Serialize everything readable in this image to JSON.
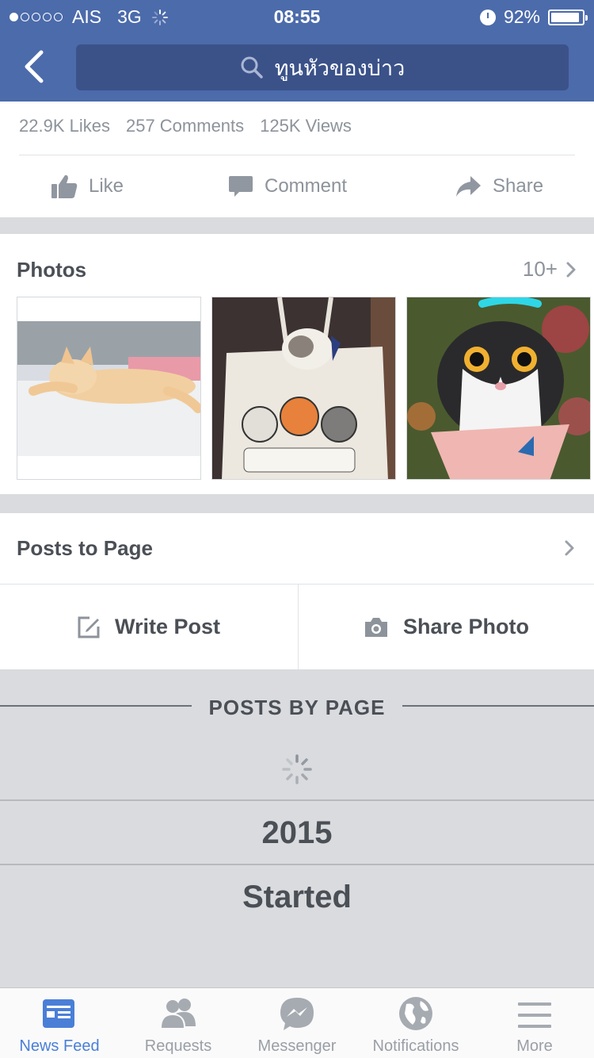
{
  "status_bar": {
    "carrier": "AIS",
    "network": "3G",
    "time": "08:55",
    "battery": "92%"
  },
  "nav": {
    "search_text": "ทูนหัวของบ่าว"
  },
  "stats": {
    "likes": "22.9K Likes",
    "comments": "257 Comments",
    "views": "125K Views"
  },
  "actions": {
    "like": "Like",
    "comment": "Comment",
    "share": "Share"
  },
  "photos": {
    "title": "Photos",
    "more": "10+"
  },
  "posts": {
    "title": "Posts to Page",
    "write": "Write Post",
    "share_photo": "Share Photo"
  },
  "posts_by_page": {
    "title": "POSTS BY PAGE",
    "year": "2015",
    "started": "Started"
  },
  "tabs": [
    {
      "label": "News Feed",
      "icon": "news-feed-icon",
      "active": true
    },
    {
      "label": "Requests",
      "icon": "friends-icon"
    },
    {
      "label": "Messenger",
      "icon": "messenger-icon"
    },
    {
      "label": "Notifications",
      "icon": "globe-icon"
    },
    {
      "label": "More",
      "icon": "menu-icon"
    }
  ],
  "colors": {
    "brand": "#4c6bab",
    "active_tab": "#4a7fd7"
  }
}
